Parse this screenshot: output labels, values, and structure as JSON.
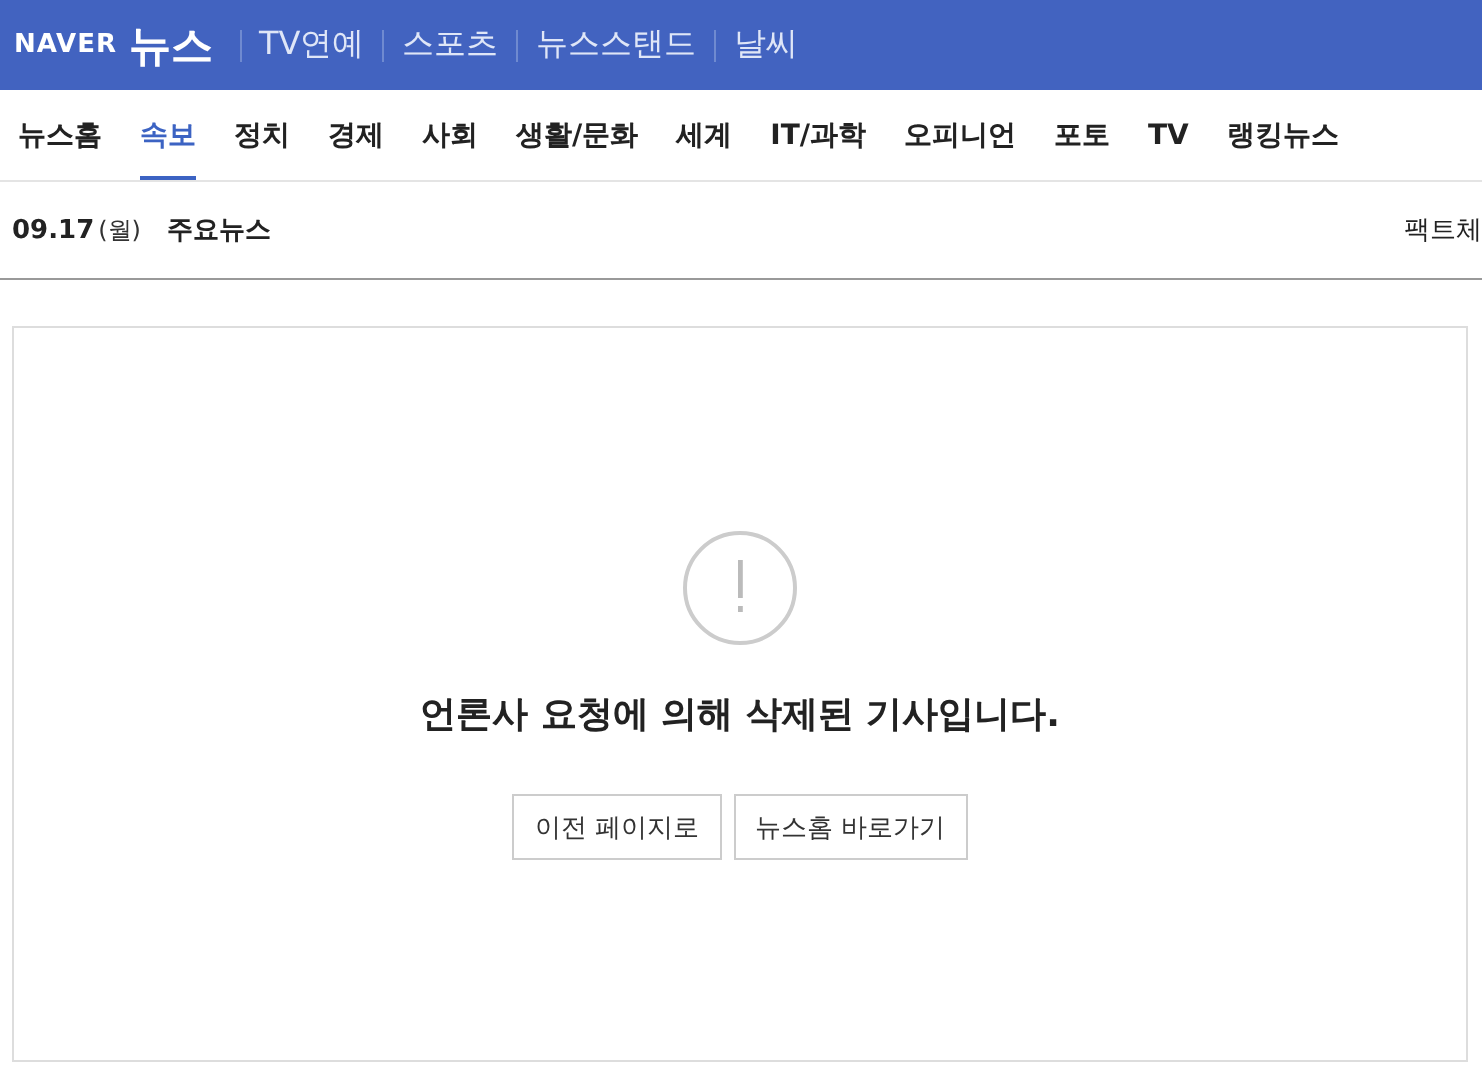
{
  "header": {
    "logo": "NAVER",
    "title": "뉴스",
    "links": [
      {
        "label": "TV연예"
      },
      {
        "label": "스포츠"
      },
      {
        "label": "뉴스스탠드"
      },
      {
        "label": "날씨"
      }
    ]
  },
  "nav": [
    {
      "label": "뉴스홈",
      "selected": false
    },
    {
      "label": "속보",
      "selected": true
    },
    {
      "label": "정치",
      "selected": false
    },
    {
      "label": "경제",
      "selected": false
    },
    {
      "label": "사회",
      "selected": false
    },
    {
      "label": "생활/문화",
      "selected": false
    },
    {
      "label": "세계",
      "selected": false
    },
    {
      "label": "IT/과학",
      "selected": false
    },
    {
      "label": "오피니언",
      "selected": false
    },
    {
      "label": "포토",
      "selected": false
    },
    {
      "label": "TV",
      "selected": false
    },
    {
      "label": "랭킹뉴스",
      "selected": false
    }
  ],
  "ticker": {
    "date": "09.17",
    "weekday": "(월)",
    "label": "주요뉴스",
    "right": "팩트체"
  },
  "notice": {
    "message": "언론사 요청에 의해 삭제된 기사입니다.",
    "buttons": [
      "이전 페이지로",
      "뉴스홈 바로가기"
    ]
  }
}
